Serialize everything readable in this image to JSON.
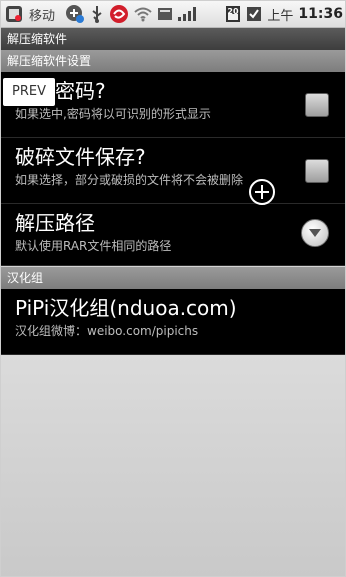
{
  "status_bar": {
    "carrier": "移动",
    "battery_level": "20",
    "time_ampm": "上午",
    "time": "11:36"
  },
  "titlebar": {
    "title": "解压缩软件"
  },
  "sections": [
    {
      "header": "解压缩软件设置",
      "items": [
        {
          "title": "显示密码?",
          "summary": "如果选中,密码将以可识别的形式显示",
          "widget": "checkbox",
          "checked": false
        },
        {
          "title": "破碎文件保存?",
          "summary": "如果选择，部分或破损的文件将不会被删除",
          "widget": "checkbox",
          "checked": false
        },
        {
          "title": "解压路径",
          "summary": "默认使用RAR文件相同的路径",
          "widget": "dropdown-icon"
        }
      ]
    },
    {
      "header": "汉化组",
      "items": [
        {
          "title": "PiPi汉化组(nduoa.com)",
          "summary": "汉化组微博：weibo.com/pipichs"
        }
      ]
    }
  ],
  "overlay": {
    "prev_label": "PREV"
  }
}
